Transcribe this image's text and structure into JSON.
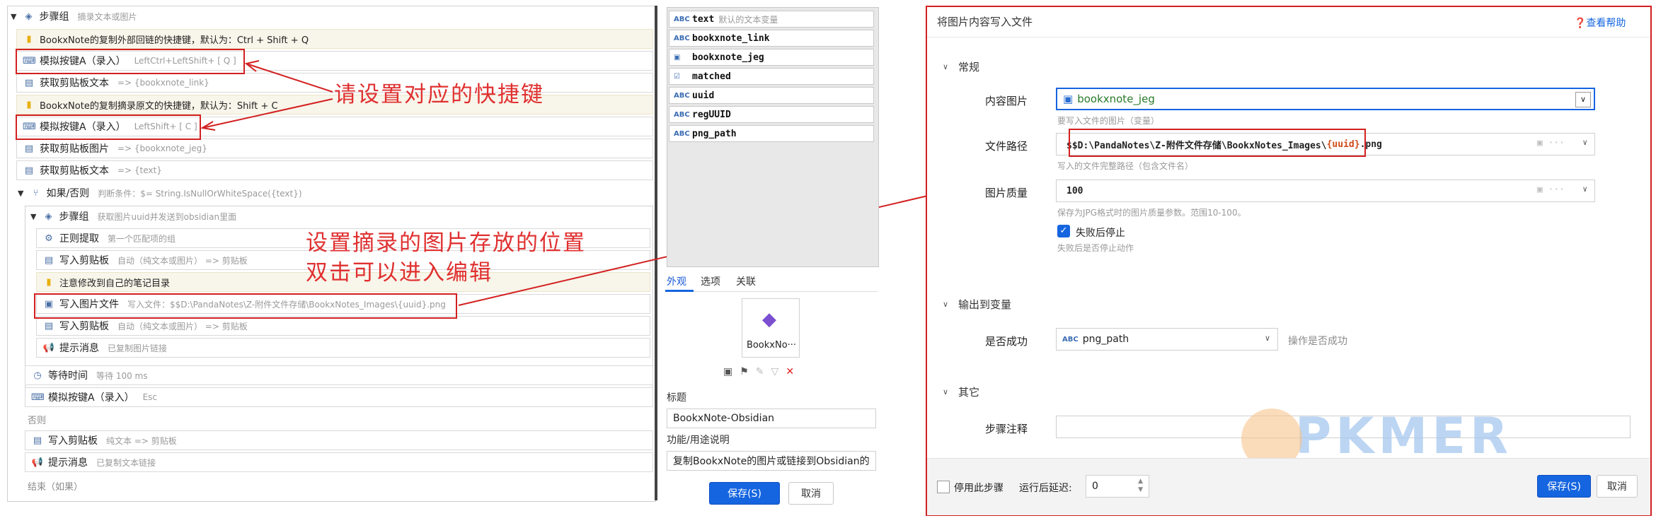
{
  "left": {
    "rows": [
      {
        "title": "步骤组",
        "sub": "摘录文本或图片"
      },
      {
        "title": "BookxNote的复制外部回链的快捷键，默认为：Ctrl + Shift + Q"
      },
      {
        "title": "模拟按键A（录入）",
        "sub": "LeftCtrl+LeftShift+ [ Q ]"
      },
      {
        "title": "获取剪贴板文本",
        "sub": "=> {bookxnote_link}"
      },
      {
        "title": "BookxNote的复制摘录原文的快捷键，默认为：Shift + C"
      },
      {
        "title": "模拟按键A（录入）",
        "sub": "LeftShift+ [ C ]"
      },
      {
        "title": "获取剪贴板图片",
        "sub": "=> {bookxnote_jeg}"
      },
      {
        "title": "获取剪贴板文本",
        "sub": "=> {text}"
      },
      {
        "title": "如果/否则",
        "sub": "判断条件：$= String.IsNullOrWhiteSpace({text})"
      },
      {
        "title": "步骤组",
        "sub": "获取图片uuid并发送到obsidian里面"
      },
      {
        "title": "正则提取",
        "sub": "第一个匹配项的组"
      },
      {
        "title": "写入剪贴板",
        "sub": "自动（纯文本或图片） => 剪贴板"
      },
      {
        "title": "注意修改到自己的笔记目录"
      },
      {
        "title": "写入图片文件",
        "sub": "写入文件：$$D:\\PandaNotes\\Z-附件文件存储\\BookxNotes_Images\\{uuid}.png"
      },
      {
        "title": "写入剪贴板",
        "sub": "自动（纯文本或图片） => 剪贴板"
      },
      {
        "title": "提示消息",
        "sub": "已复制图片链接"
      },
      {
        "title": "等待时间",
        "sub": "等待 100 ms"
      },
      {
        "title": "模拟按键A（录入）",
        "sub": "Esc"
      },
      {
        "title": "否则"
      },
      {
        "title": "写入剪贴板",
        "sub": "纯文本 => 剪贴板"
      },
      {
        "title": "提示消息",
        "sub": "已复制文本链接"
      },
      {
        "title": "结束（如果）"
      }
    ],
    "annotations": {
      "shortcut": "请设置对应的快捷键",
      "image_line1": "设置摘录的图片存放的位置",
      "image_line2": "双击可以进入编辑"
    }
  },
  "variables": [
    {
      "icon": "ABC",
      "name": "text",
      "desc": "默认的文本变量"
    },
    {
      "icon": "ABC",
      "name": "bookxnote_link",
      "desc": ""
    },
    {
      "icon": "image-icon",
      "name": "bookxnote_jeg",
      "desc": ""
    },
    {
      "icon": "checkbox-icon",
      "name": "matched",
      "desc": ""
    },
    {
      "icon": "ABC",
      "name": "uuid",
      "desc": ""
    },
    {
      "icon": "ABC",
      "name": "regUUID",
      "desc": ""
    },
    {
      "icon": "ABC",
      "name": "png_path",
      "desc": ""
    }
  ],
  "props": {
    "tabs": [
      "外观",
      "选项",
      "关联"
    ],
    "icon_label": "BookxNo···",
    "title_label": "标题",
    "title_value": "BookxNote-Obsidian",
    "desc_label": "功能/用途说明",
    "desc_value": "复制BookxNote的图片或链接到Obsidian的",
    "save": "保存(S)",
    "cancel": "取消"
  },
  "dialog": {
    "title": "将图片内容写入文件",
    "help": "查看帮助",
    "section_general": "常规",
    "image_label": "内容图片",
    "image_value": "bookxnote_jeg",
    "image_hint": "要写入文件的图片（变量）",
    "path_label": "文件路径",
    "path_prefix": "$$D:\\PandaNotes\\Z-附件文件存储\\BookxNotes_Images\\",
    "path_var": "{uuid}",
    "path_suffix": ".png",
    "path_hint": "写入的文件完整路径（包含文件名）",
    "quality_label": "图片质量",
    "quality_value": "100",
    "quality_hint": "保存为JPG格式时的图片质量参数。范围10-100。",
    "stop_label": "失败后停止",
    "stop_hint": "失败后是否停止动作",
    "section_output": "输出到变量",
    "success_label": "是否成功",
    "success_value": "png_path",
    "success_hint": "操作是否成功",
    "section_other": "其它",
    "note_label": "步骤注释",
    "disable_label": "停用此步骤",
    "delay_label": "运行后延迟:",
    "delay_value": "0",
    "save": "保存(S)",
    "cancel": "取消",
    "watermark": "PKMER"
  },
  "colors": {
    "accent": "#1565e0",
    "annotation": "#e03030",
    "var_orange": "#d04a1a"
  }
}
